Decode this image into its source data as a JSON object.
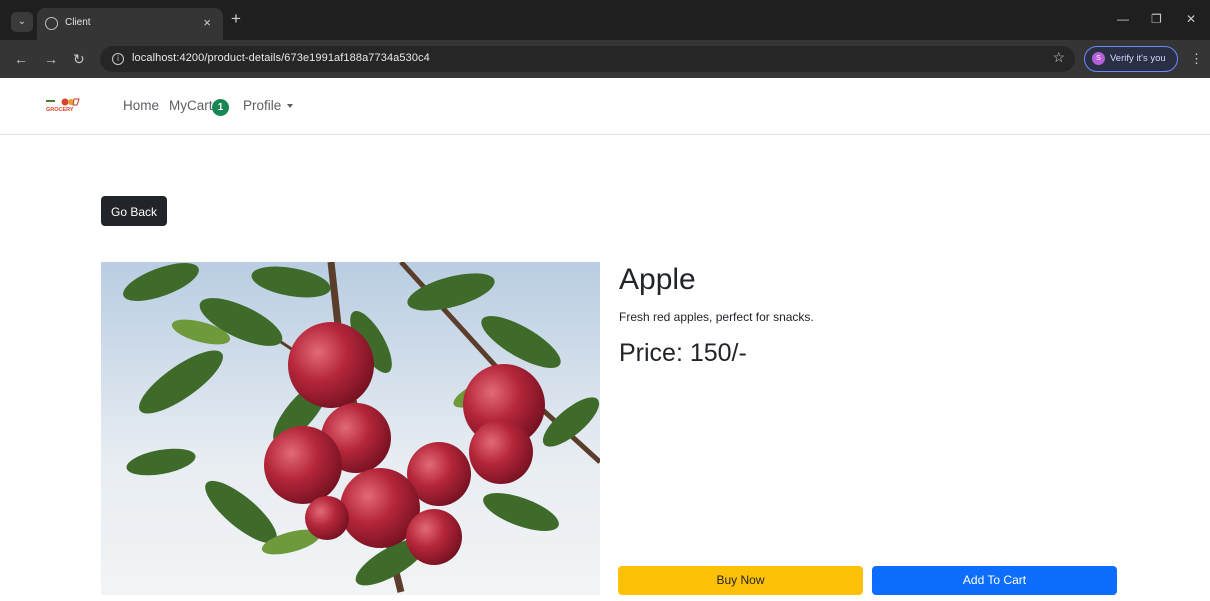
{
  "browser": {
    "tab_title": "Client",
    "tab_close": "×",
    "new_tab": "+",
    "url": "localhost:4200/product-details/673e1991af188a7734a530c4",
    "verify_label": "Verify it's you",
    "verify_avatar": "S"
  },
  "navbar": {
    "logo_text": "GROCERY",
    "home": "Home",
    "mycart": "MyCart",
    "cart_count": "1",
    "profile": "Profile"
  },
  "product": {
    "go_back": "Go Back",
    "name": "Apple",
    "description": "Fresh red apples, perfect for snacks.",
    "price": "Price: 150/-",
    "buy_now": "Buy Now",
    "add_to_cart": "Add To Cart"
  },
  "colors": {
    "badge": "#198754",
    "buy_button": "#ffc107",
    "cart_button": "#0d6efd",
    "go_back_button": "#212529"
  },
  "icons": [
    "tab-list-icon",
    "globe-icon",
    "close-icon",
    "back-icon",
    "forward-icon",
    "reload-icon",
    "site-info-icon",
    "bookmark-star-icon",
    "menu-kebab-icon",
    "caret-down-icon"
  ]
}
